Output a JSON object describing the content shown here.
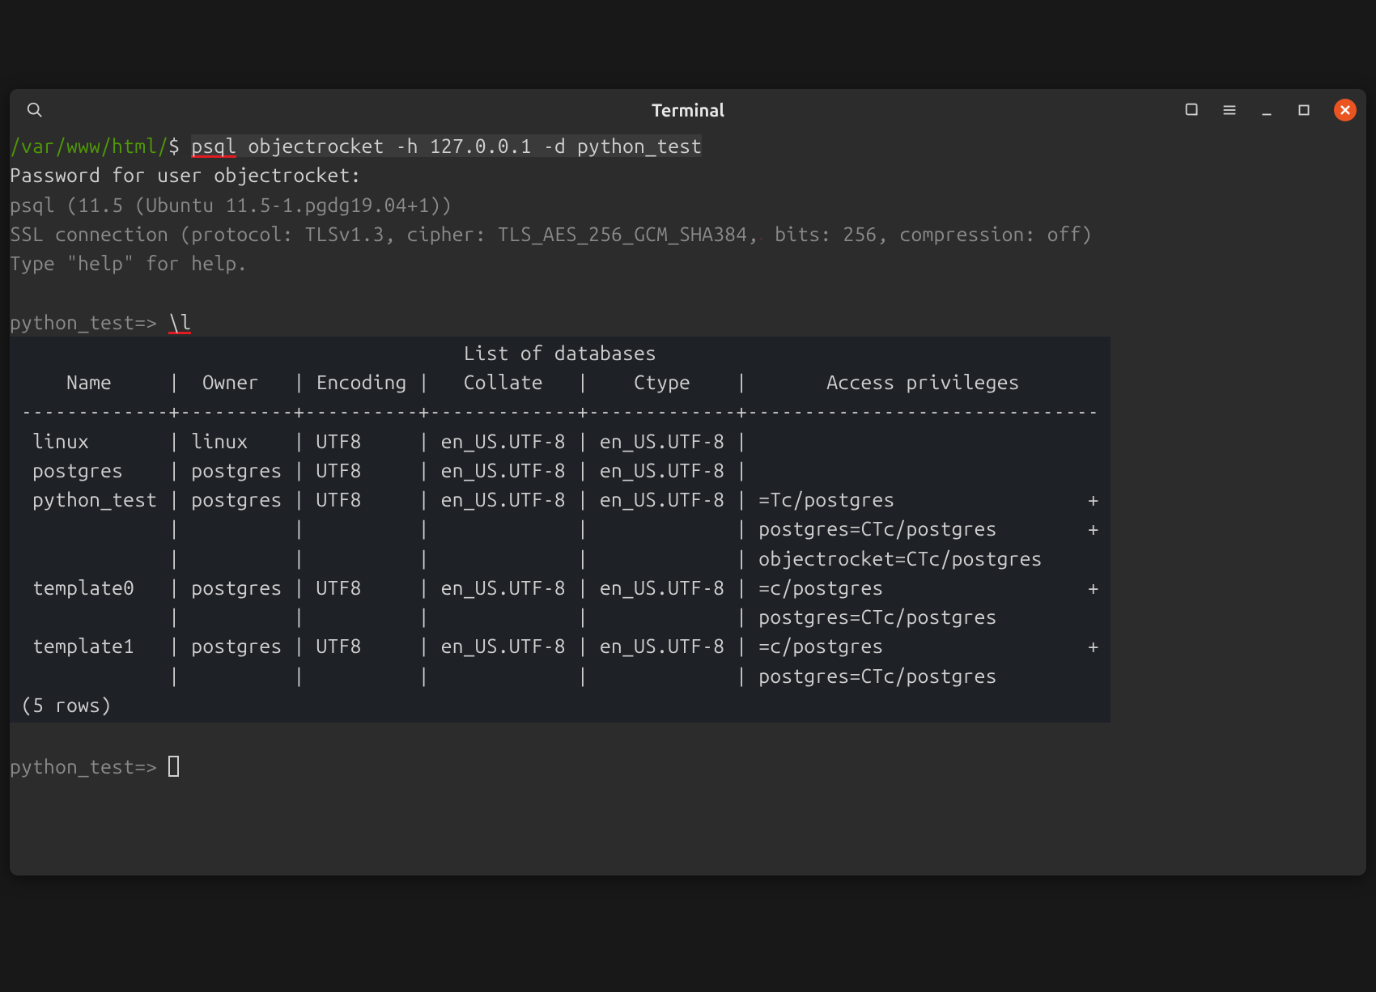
{
  "window": {
    "title": "Terminal"
  },
  "prompt": {
    "path": "/var/www/html/",
    "symbol": "$",
    "psql_prompt": "python_test=>"
  },
  "commands": {
    "psql_cmd_part1": "psql",
    "psql_cmd_rest": " objectrocket -h 127.0.0.1 -d python_test",
    "list_cmd": "\\l"
  },
  "output": {
    "password_line": "Password for user objectrocket:",
    "version_line": "psql (11.5 (Ubuntu 11.5-1.pgdg19.04+1))",
    "ssl_line": "SSL connection (protocol: TLSv1.3, cipher: TLS_AES_256_GCM_SHA384, bits: 256, compression: off)",
    "help_line": "Type \"help\" for help.",
    "list_title": "                                       List of databases",
    "headers": "    Name     |  Owner   | Encoding |   Collate   |    Ctype    |       Access privileges       ",
    "divider": "-------------+----------+----------+-------------+-------------+-------------------------------",
    "r0": " linux       | linux    | UTF8     | en_US.UTF-8 | en_US.UTF-8 | ",
    "r1": " postgres    | postgres | UTF8     | en_US.UTF-8 | en_US.UTF-8 | ",
    "r2": " python_test | postgres | UTF8     | en_US.UTF-8 | en_US.UTF-8 | =Tc/postgres                 +",
    "r2b": "             |          |          |             |             | postgres=CTc/postgres        +",
    "r2c": "             |          |          |             |             | objectrocket=CTc/postgres",
    "r3": " template0   | postgres | UTF8     | en_US.UTF-8 | en_US.UTF-8 | =c/postgres                  +",
    "r3b": "             |          |          |             |             | postgres=CTc/postgres",
    "r4": " template1   | postgres | UTF8     | en_US.UTF-8 | en_US.UTF-8 | =c/postgres                  +",
    "r4b": "             |          |          |             |             | postgres=CTc/postgres",
    "row_count": "(5 rows)"
  }
}
